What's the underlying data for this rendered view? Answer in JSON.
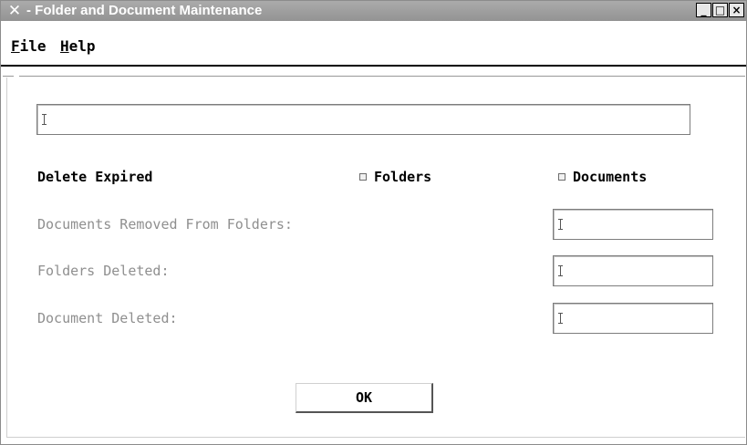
{
  "window": {
    "icon": "x-logo-icon",
    "title": "- Folder and Document Maintenance",
    "controls": [
      {
        "name": "minimize-button",
        "glyph": "_"
      },
      {
        "name": "maximize-button",
        "glyph": "□"
      },
      {
        "name": "close-button",
        "glyph": "×"
      }
    ]
  },
  "menu": {
    "file": {
      "mnemonic": "F",
      "rest": "ile"
    },
    "help": {
      "mnemonic": "H",
      "rest": "elp"
    }
  },
  "form": {
    "top_field_value": "",
    "delete_expired_label": "Delete Expired",
    "folders_label": "Folders",
    "folders_checked": false,
    "documents_label": "Documents",
    "documents_checked": false,
    "docs_removed_label": "Documents Removed From Folders:",
    "docs_removed_value": "",
    "folders_deleted_label": "Folders Deleted:",
    "folders_deleted_value": "",
    "document_deleted_label": "Document Deleted:",
    "document_deleted_value": "",
    "ok_label": "OK"
  }
}
